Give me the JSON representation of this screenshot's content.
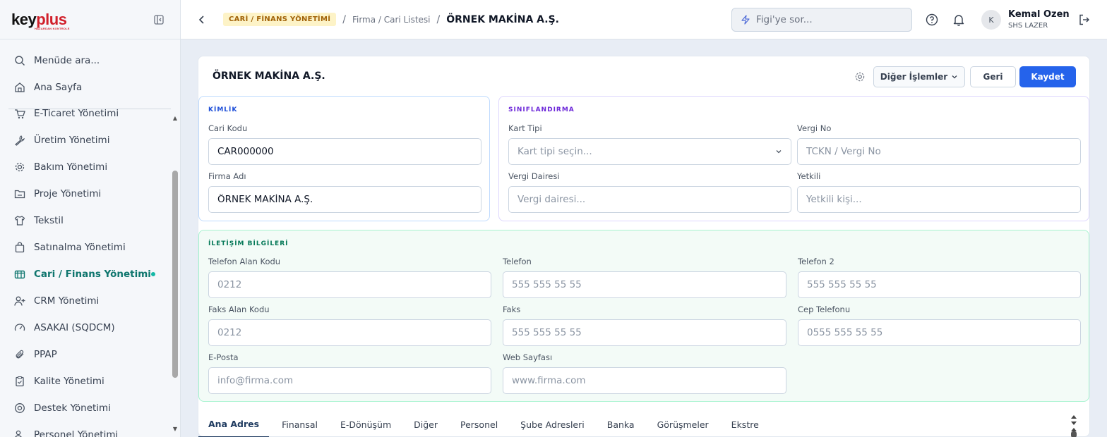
{
  "brand": {
    "logo_main": "key",
    "logo_accent": "plus",
    "logo_tag": "HAZARDAN KONTROLE"
  },
  "sidebar": {
    "search_label": "Menüde ara...",
    "home_label": "Ana Sayfa",
    "items": [
      {
        "label": "E-Ticaret Yönetimi",
        "icon": "cart-icon"
      },
      {
        "label": "Üretim Yönetimi",
        "icon": "wrench-icon"
      },
      {
        "label": "Bakım Yönetimi",
        "icon": "gear-icon"
      },
      {
        "label": "Proje Yönetimi",
        "icon": "folder-icon"
      },
      {
        "label": "Tekstil",
        "icon": "shirt-icon"
      },
      {
        "label": "Satınalma Yönetimi",
        "icon": "bag-icon"
      },
      {
        "label": "Cari / Finans Yönetimi",
        "icon": "wallet-icon",
        "active": true
      },
      {
        "label": "CRM Yönetimi",
        "icon": "user-plus-icon"
      },
      {
        "label": "ASAKAI (SQDCM)",
        "icon": "gauge-icon"
      },
      {
        "label": "PPAP",
        "icon": "paperclip-icon"
      },
      {
        "label": "Kalite Yönetimi",
        "icon": "clipboard-icon"
      },
      {
        "label": "Destek Yönetimi",
        "icon": "lifebuoy-icon"
      },
      {
        "label": "Personel Yönetimi",
        "icon": "users-icon"
      }
    ]
  },
  "header": {
    "breadcrumb_badge": "CARİ / FİNANS YÖNETİMİ",
    "breadcrumb_link": "Firma / Cari Listesi",
    "breadcrumb_sep": "/",
    "breadcrumb_current": "ÖRNEK MAKİNA A.Ş.",
    "ai_search_placeholder": "Figi'ye sor...",
    "user_initial": "K",
    "user_name": "Kemal Ozen",
    "user_org": "SHS LAZER"
  },
  "card": {
    "title": "ÖRNEK MAKİNA A.Ş.",
    "btn_other": "Diğer İşlemler",
    "btn_back": "Geri",
    "btn_save": "Kaydet"
  },
  "kimlik": {
    "heading": "KİMLİK",
    "cari_kodu_label": "Cari Kodu",
    "cari_kodu_value": "CAR000000",
    "firma_adi_label": "Firma Adı",
    "firma_adi_value": "ÖRNEK MAKİNA A.Ş."
  },
  "siniflandirma": {
    "heading": "SINIFLANDIRMA",
    "kart_tipi_label": "Kart Tipi",
    "kart_tipi_placeholder": "Kart tipi seçin...",
    "vergi_no_label": "Vergi No",
    "vergi_no_placeholder": "TCKN / Vergi No",
    "vergi_dairesi_label": "Vergi Dairesi",
    "vergi_dairesi_placeholder": "Vergi dairesi...",
    "yetkili_label": "Yetkili",
    "yetkili_placeholder": "Yetkili kişi..."
  },
  "iletisim": {
    "heading": "İLETİŞİM BİLGİLERİ",
    "tel_alan_label": "Telefon Alan Kodu",
    "tel_alan_placeholder": "0212",
    "telefon_label": "Telefon",
    "telefon_placeholder": "555 555 55 55",
    "telefon2_label": "Telefon 2",
    "telefon2_placeholder": "555 555 55 55",
    "faks_alan_label": "Faks Alan Kodu",
    "faks_alan_placeholder": "0212",
    "faks_label": "Faks",
    "faks_placeholder": "555 555 55 55",
    "cep_label": "Cep Telefonu",
    "cep_placeholder": "0555 555 55 55",
    "eposta_label": "E-Posta",
    "eposta_placeholder": "info@firma.com",
    "web_label": "Web Sayfası",
    "web_placeholder": "www.firma.com"
  },
  "tabs": [
    {
      "label": "Ana Adres",
      "active": true
    },
    {
      "label": "Finansal"
    },
    {
      "label": "E-Dönüşüm"
    },
    {
      "label": "Diğer"
    },
    {
      "label": "Personel"
    },
    {
      "label": "Şube Adresleri"
    },
    {
      "label": "Banka"
    },
    {
      "label": "Görüşmeler"
    },
    {
      "label": "Ekstre"
    }
  ],
  "colors": {
    "accent": "#2563eb",
    "active_menu": "#0f766e",
    "kimlik_heading": "#1d4ed8",
    "siniflandirma_heading": "#6d28d9",
    "iletisim_heading": "#047857"
  }
}
